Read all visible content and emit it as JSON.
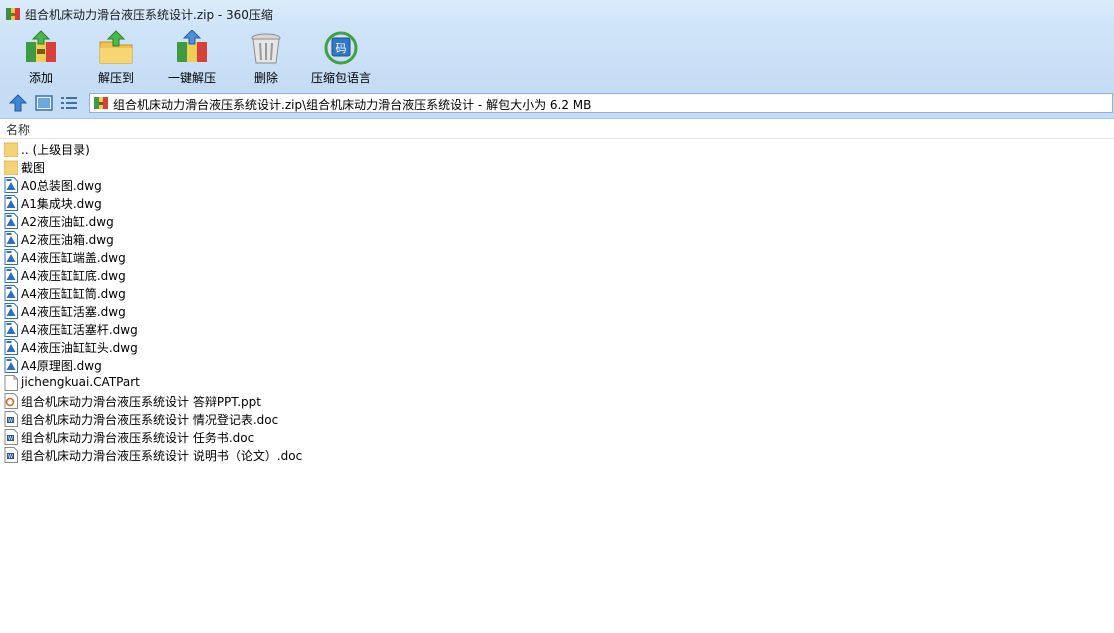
{
  "window": {
    "title": "组合机床动力滑台液压系统设计.zip - 360压缩"
  },
  "toolbar": {
    "buttons": [
      {
        "label": "添加",
        "icon": "add-archive-icon"
      },
      {
        "label": "解压到",
        "icon": "extract-to-icon"
      },
      {
        "label": "一键解压",
        "icon": "one-click-extract-icon"
      },
      {
        "label": "删除",
        "icon": "delete-icon"
      },
      {
        "label": "压缩包语言",
        "icon": "archive-language-icon"
      }
    ]
  },
  "address": {
    "path": "组合机床动力滑台液压系统设计.zip\\组合机床动力滑台液压系统设计 - 解包大小为 6.2 MB"
  },
  "list": {
    "column_name": "名称",
    "items": [
      {
        "name": ".. (上级目录)",
        "type": "folder"
      },
      {
        "name": "截图",
        "type": "folder"
      },
      {
        "name": "A0总装图.dwg",
        "type": "dwg"
      },
      {
        "name": "A1集成块.dwg",
        "type": "dwg"
      },
      {
        "name": "A2液压油缸.dwg",
        "type": "dwg"
      },
      {
        "name": "A2液压油箱.dwg",
        "type": "dwg"
      },
      {
        "name": "A4液压缸端盖.dwg",
        "type": "dwg"
      },
      {
        "name": "A4液压缸缸底.dwg",
        "type": "dwg"
      },
      {
        "name": "A4液压缸缸筒.dwg",
        "type": "dwg"
      },
      {
        "name": "A4液压缸活塞.dwg",
        "type": "dwg"
      },
      {
        "name": "A4液压缸活塞杆.dwg",
        "type": "dwg"
      },
      {
        "name": "A4液压油缸缸头.dwg",
        "type": "dwg"
      },
      {
        "name": "A4原理图.dwg",
        "type": "dwg"
      },
      {
        "name": "jichengkuai.CATPart",
        "type": "generic"
      },
      {
        "name": "组合机床动力滑台液压系统设计 答辩PPT.ppt",
        "type": "ppt"
      },
      {
        "name": "组合机床动力滑台液压系统设计 情况登记表.doc",
        "type": "doc"
      },
      {
        "name": "组合机床动力滑台液压系统设计 任务书.doc",
        "type": "doc"
      },
      {
        "name": "组合机床动力滑台液压系统设计 说明书（论文）.doc",
        "type": "doc"
      }
    ]
  },
  "colors": {
    "chrome": "#c4dcf4",
    "folder": "#f5d27a",
    "dwg": "#2f6fc2",
    "ppt": "#d2691e",
    "doc": "#2b5797"
  }
}
